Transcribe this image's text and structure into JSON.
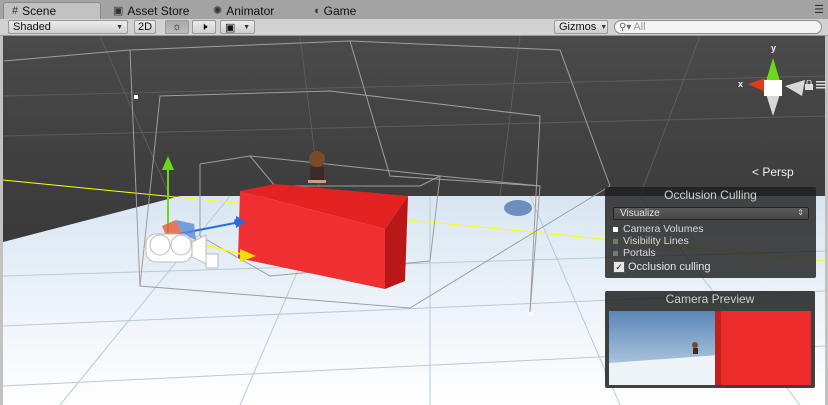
{
  "tabs": [
    {
      "label": "Scene",
      "icon": "grid-icon",
      "active": true
    },
    {
      "label": "Asset Store",
      "icon": "store-icon",
      "active": false
    },
    {
      "label": "Animator",
      "icon": "animator-icon",
      "active": false
    },
    {
      "label": "Game",
      "icon": "game-icon",
      "active": false
    }
  ],
  "toolbar": {
    "shading_mode": "Shaded",
    "mode_2d": "2D",
    "lighting_icon": "sun-icon",
    "audio_icon": "speaker-icon",
    "effects_icon": "image-icon",
    "gizmos_label": "Gizmos",
    "search_placeholder": "All"
  },
  "scene_gizmo": {
    "projection_label": "Persp",
    "x_label": "x",
    "y_label": "y"
  },
  "occlusion_panel": {
    "title": "Occlusion Culling",
    "mode_value": "Visualize",
    "items": [
      {
        "label": "Camera Volumes",
        "selected": true
      },
      {
        "label": "Visibility Lines",
        "selected": false
      },
      {
        "label": "Portals",
        "selected": false
      }
    ],
    "toggle_label": "Occlusion culling",
    "toggle_checked": true
  },
  "camera_preview": {
    "title": "Camera Preview"
  },
  "colors": {
    "cube_red": "#f02a2a",
    "grid_line": "#ffff00",
    "floor": "#e8eef4",
    "sky_dark": "#3a3a3a",
    "axis_x": "#e03a1a",
    "axis_y": "#6cd81c",
    "axis_z": "#2f6bd8"
  }
}
